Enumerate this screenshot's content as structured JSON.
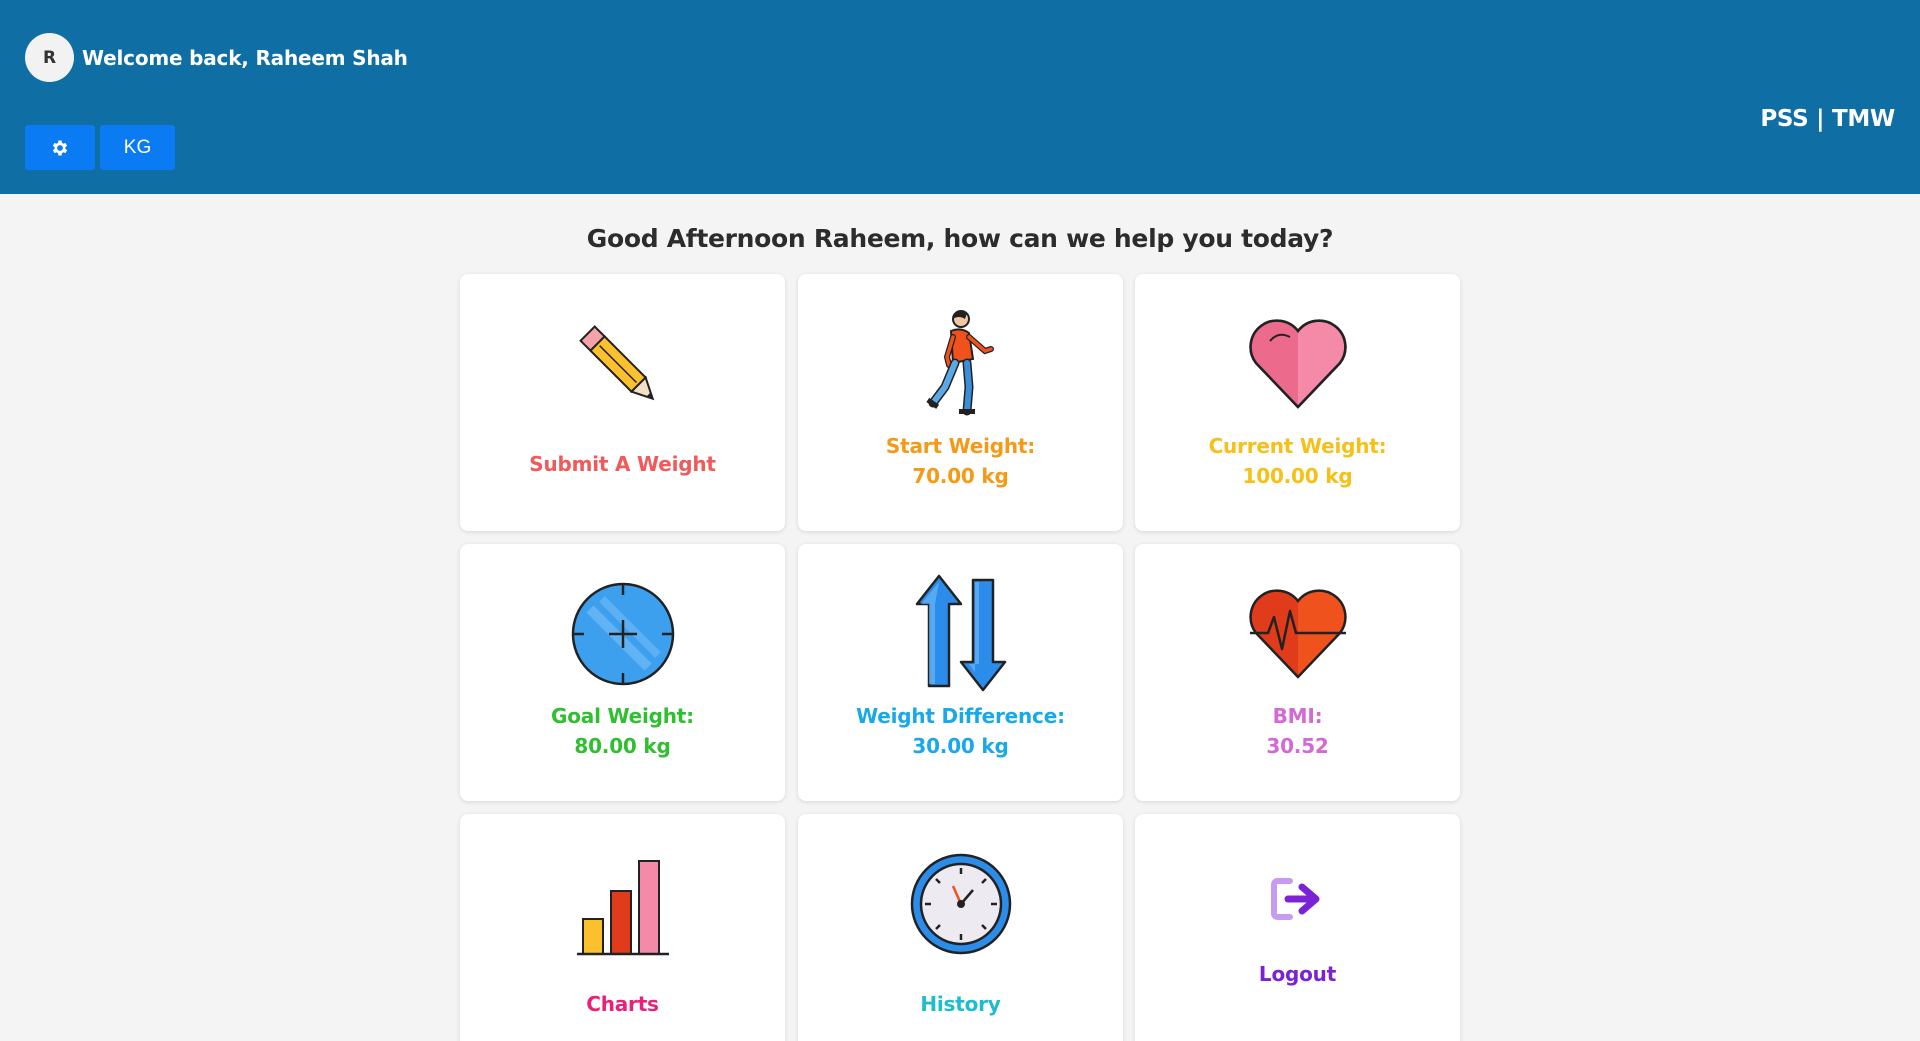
{
  "header": {
    "avatar_initial": "R",
    "welcome": "Welcome back, Raheem Shah",
    "unit_button": "KG",
    "brand": "PSS | TMW"
  },
  "greeting": "Good Afternoon Raheem, how can we help you today?",
  "cards": {
    "submit": {
      "label": "Submit A Weight",
      "color": "#f05a5a",
      "icon": "pencil-icon"
    },
    "start": {
      "label": "Start Weight:",
      "value": "70.00 kg",
      "color": "#f59a16",
      "icon": "walking-person-icon"
    },
    "current": {
      "label": "Current Weight:",
      "value": "100.00 kg",
      "color": "#f5c018",
      "icon": "heart-icon"
    },
    "goal": {
      "label": "Goal Weight:",
      "value": "80.00 kg",
      "color": "#2fbf2f",
      "icon": "target-icon"
    },
    "difference": {
      "label": "Weight Difference:",
      "value": "30.00 kg",
      "color": "#1aa9e8",
      "icon": "up-down-arrows-icon"
    },
    "bmi": {
      "label": "BMI:",
      "value": "30.52",
      "color": "#d368d6",
      "icon": "heartbeat-icon"
    },
    "charts": {
      "label": "Charts",
      "color": "#e8217a",
      "icon": "bar-chart-icon"
    },
    "history": {
      "label": "History",
      "color": "#1dbdcf",
      "icon": "clock-icon"
    },
    "logout": {
      "label": "Logout",
      "color": "#7b22d4",
      "icon": "logout-icon"
    }
  }
}
